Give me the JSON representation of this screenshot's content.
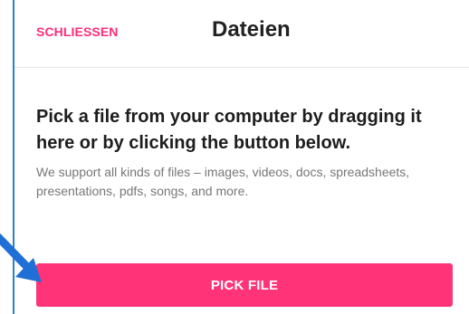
{
  "header": {
    "close_label": "SCHLIESSEN",
    "title": "Dateien"
  },
  "main": {
    "heading": "Pick a file from your computer by dragging it here or by clicking the button below.",
    "description": "We support all kinds of files – images, videos, docs, spreadsheets, presentations, pdfs, songs, and more.",
    "pick_button_label": "PICK FILE"
  },
  "colors": {
    "accent": "#ff3378",
    "frame_border": "#2c7fd0",
    "arrow": "#1f6fd6"
  },
  "icons": [
    "arrow-pointer-icon"
  ]
}
